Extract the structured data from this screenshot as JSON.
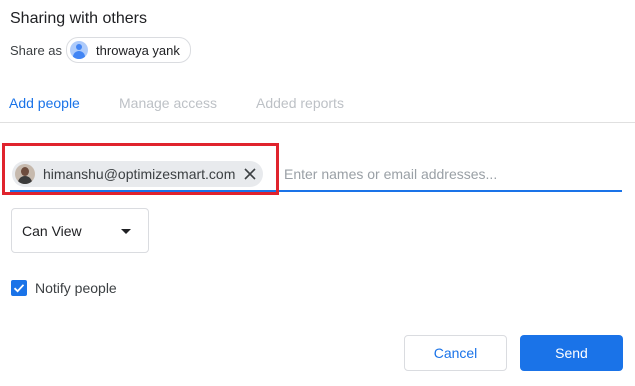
{
  "dialog": {
    "title": "Sharing with others",
    "share_as_label": "Share as",
    "account_name": "throwaya yank"
  },
  "tabs": [
    {
      "label": "Add people",
      "active": true
    },
    {
      "label": "Manage access",
      "active": false
    },
    {
      "label": "Added reports",
      "active": false
    }
  ],
  "recipients": {
    "chips": [
      {
        "email": "himanshu@optimizesmart.com"
      }
    ],
    "placeholder": "Enter names or email addresses...",
    "value": ""
  },
  "role": {
    "selected": "Can View"
  },
  "notify": {
    "label": "Notify people",
    "checked": true
  },
  "actions": {
    "cancel_label": "Cancel",
    "send_label": "Send"
  },
  "colors": {
    "accent": "#1a73e8",
    "highlight": "#e0232d",
    "tab_inactive": "#bdc1c6"
  },
  "icons": {
    "remove_chip": "close-icon",
    "role_dropdown": "caret-down-icon",
    "checkbox": "check-icon"
  }
}
